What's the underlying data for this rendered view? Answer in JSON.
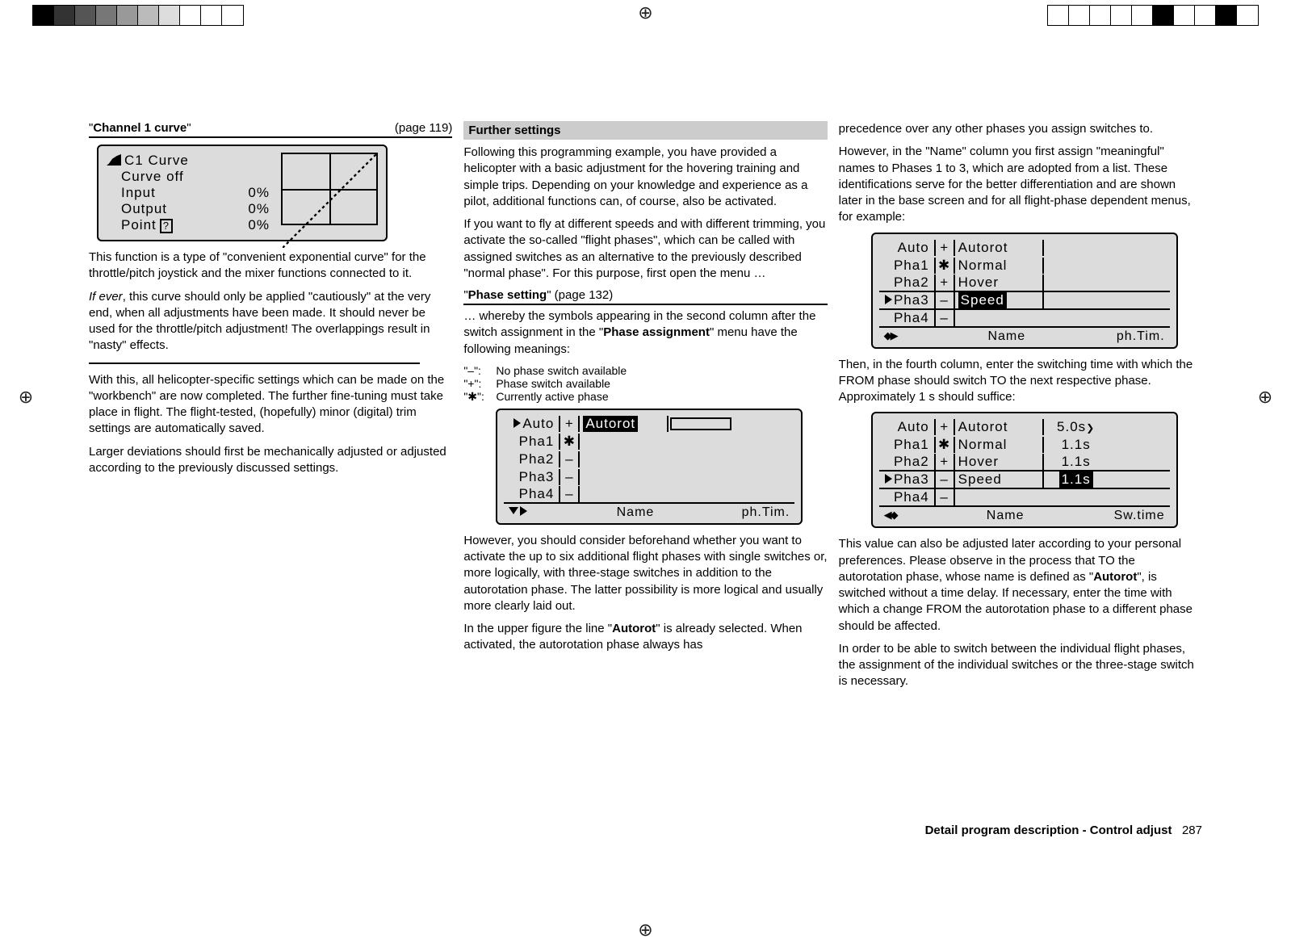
{
  "col1": {
    "title_q": "\"",
    "title": "Channel 1 curve",
    "title_end": "\"",
    "pageref": "(page 119)",
    "lcd": {
      "title": "C1  Curve",
      "line2": "Curve  off",
      "input_l": "Input",
      "input_v": "0%",
      "output_l": "Output",
      "output_v": "0%",
      "point_l": "Point",
      "point_q": "?",
      "point_v": "0%"
    },
    "p1": "This function is a type of \"convenient exponential curve\" for the throttle/pitch joystick and the mixer functions connected to it.",
    "p2a": "If ever",
    "p2b": ", this curve should only be applied \"cautiously\" at the very end, when all adjustments have been made. It should never be used for the throttle/pitch adjustment! The overlappings result in \"nasty\" effects.",
    "p3": "With this, all helicopter-specific settings which can be made on the \"workbench\" are now completed. The further fine-tuning must take place in flight. The flight-tested, (hopefully) minor (digital) trim settings are automatically saved.",
    "p4": "Larger deviations should first be mechanically adjusted or adjusted according to the previously discussed settings."
  },
  "col2": {
    "h1": "Further settings",
    "p1": "Following this programming example, you have provided a helicopter with a basic adjustment for the hovering training and simple trips. Depending on your knowledge and experience as a pilot, additional functions can, of course, also be activated.",
    "p2": "If you want to fly at different speeds and with different trimming, you activate the so-called \"flight phases\", which can be called with assigned switches as an alternative to the previously described \"normal phase\". For this purpose, first open the menu …",
    "h2a": "\"",
    "h2b": "Phase setting",
    "h2c": "\" (page 132)",
    "p3a": "… whereby the symbols appearing in the second column after the switch assignment in the \"",
    "p3b": "Phase assignment",
    "p3c": "\" menu have the following meanings:",
    "sym1": "\"–\":",
    "def1": "No phase switch available",
    "sym2": "\"+\":",
    "def2": "Phase switch available",
    "sym3": "\"✱\":",
    "def3": "Currently active phase",
    "lcd": {
      "r1a": "Auto",
      "r1b": "+",
      "r1c": "Autorot",
      "r2a": "Pha1",
      "r2b": "✱",
      "r3a": "Pha2",
      "r3b": "–",
      "r4a": "Pha3",
      "r4b": "–",
      "r5a": "Pha4",
      "r5b": "–",
      "foot1": "Name",
      "foot2": "ph.Tim."
    },
    "p4": "However, you should consider beforehand whether you want to activate the up to six additional flight phases with single switches or, more logically, with three-stage switches in addition to the autorotation phase. The latter possibility is more logical and usually more clearly laid out.",
    "p5a": "In the upper figure the line \"",
    "p5b": "Autorot",
    "p5c": "\" is already selected. When activated, the autorotation phase always has"
  },
  "col3": {
    "p1": "precedence over any other phases you assign switches to.",
    "p2": "However, in the \"Name\" column you first assign \"meaningful\" names to Phases 1 to 3, which are adopted from a list. These identifications serve for the better differentiation and are shown later in the base screen and for all flight-phase dependent menus, for example:",
    "lcd1": {
      "r1a": "Auto",
      "r1b": "+",
      "r1c": "Autorot",
      "r2a": "Pha1",
      "r2b": "✱",
      "r2c": "Normal",
      "r3a": "Pha2",
      "r3b": "+",
      "r3c": "Hover",
      "r4a": "Pha3",
      "r4b": "–",
      "r4c": "Speed",
      "r5a": "Pha4",
      "r5b": "–",
      "foot1": "Name",
      "foot2": "ph.Tim."
    },
    "p3": "Then, in the fourth column, enter the switching time with which the FROM phase should switch TO the next respective phase. Approximately 1 s should suffice:",
    "lcd2": {
      "r1a": "Auto",
      "r1b": "+",
      "r1c": "Autorot",
      "r1d": "5.0s",
      "r2a": "Pha1",
      "r2b": "✱",
      "r2c": "Normal",
      "r2d": "1.1s",
      "r3a": "Pha2",
      "r3b": "+",
      "r3c": "Hover",
      "r3d": "1.1s",
      "r4a": "Pha3",
      "r4b": "–",
      "r4c": "Speed",
      "r4d": "1.1s",
      "r5a": "Pha4",
      "r5b": "–",
      "foot1": "Name",
      "foot2": "Sw.time"
    },
    "p4a": "This value can also be adjusted later according to your personal preferences. Please observe in the process that TO the autorotation phase, whose name is defined as \"",
    "p4b": "Autorot",
    "p4c": "\", is switched without a time delay. If necessary, enter the time with which a change FROM the autorotation phase to a different phase should be affected.",
    "p5": "In order to be able to switch between the individual flight phases, the assignment of the individual switches or the three-stage switch is necessary."
  },
  "footer": {
    "text": "Detail program description - Control adjust",
    "page": "287"
  }
}
